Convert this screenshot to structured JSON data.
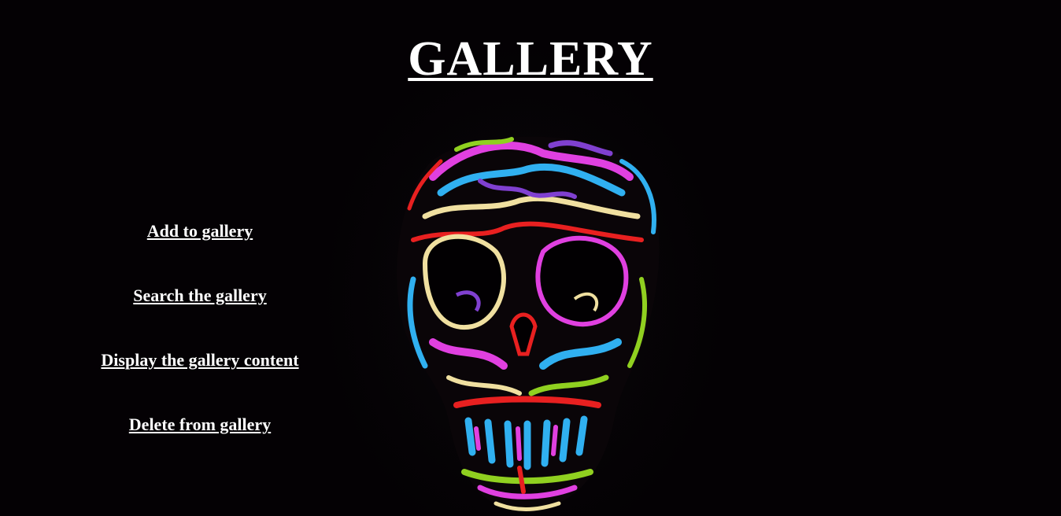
{
  "page": {
    "title": "GALLERY",
    "background_color": "#040104",
    "text_color": "#ffffff"
  },
  "menu": {
    "items": [
      {
        "label": "Add to gallery"
      },
      {
        "label": "Search the gallery"
      },
      {
        "label": "Display the gallery content"
      },
      {
        "label": "Delete from gallery"
      }
    ]
  },
  "artwork": {
    "subject": "psychedelic-skull-illustration",
    "palette": [
      "#e040e0",
      "#30b0f0",
      "#e82020",
      "#f0e0a0",
      "#90d020",
      "#8040d0"
    ]
  }
}
